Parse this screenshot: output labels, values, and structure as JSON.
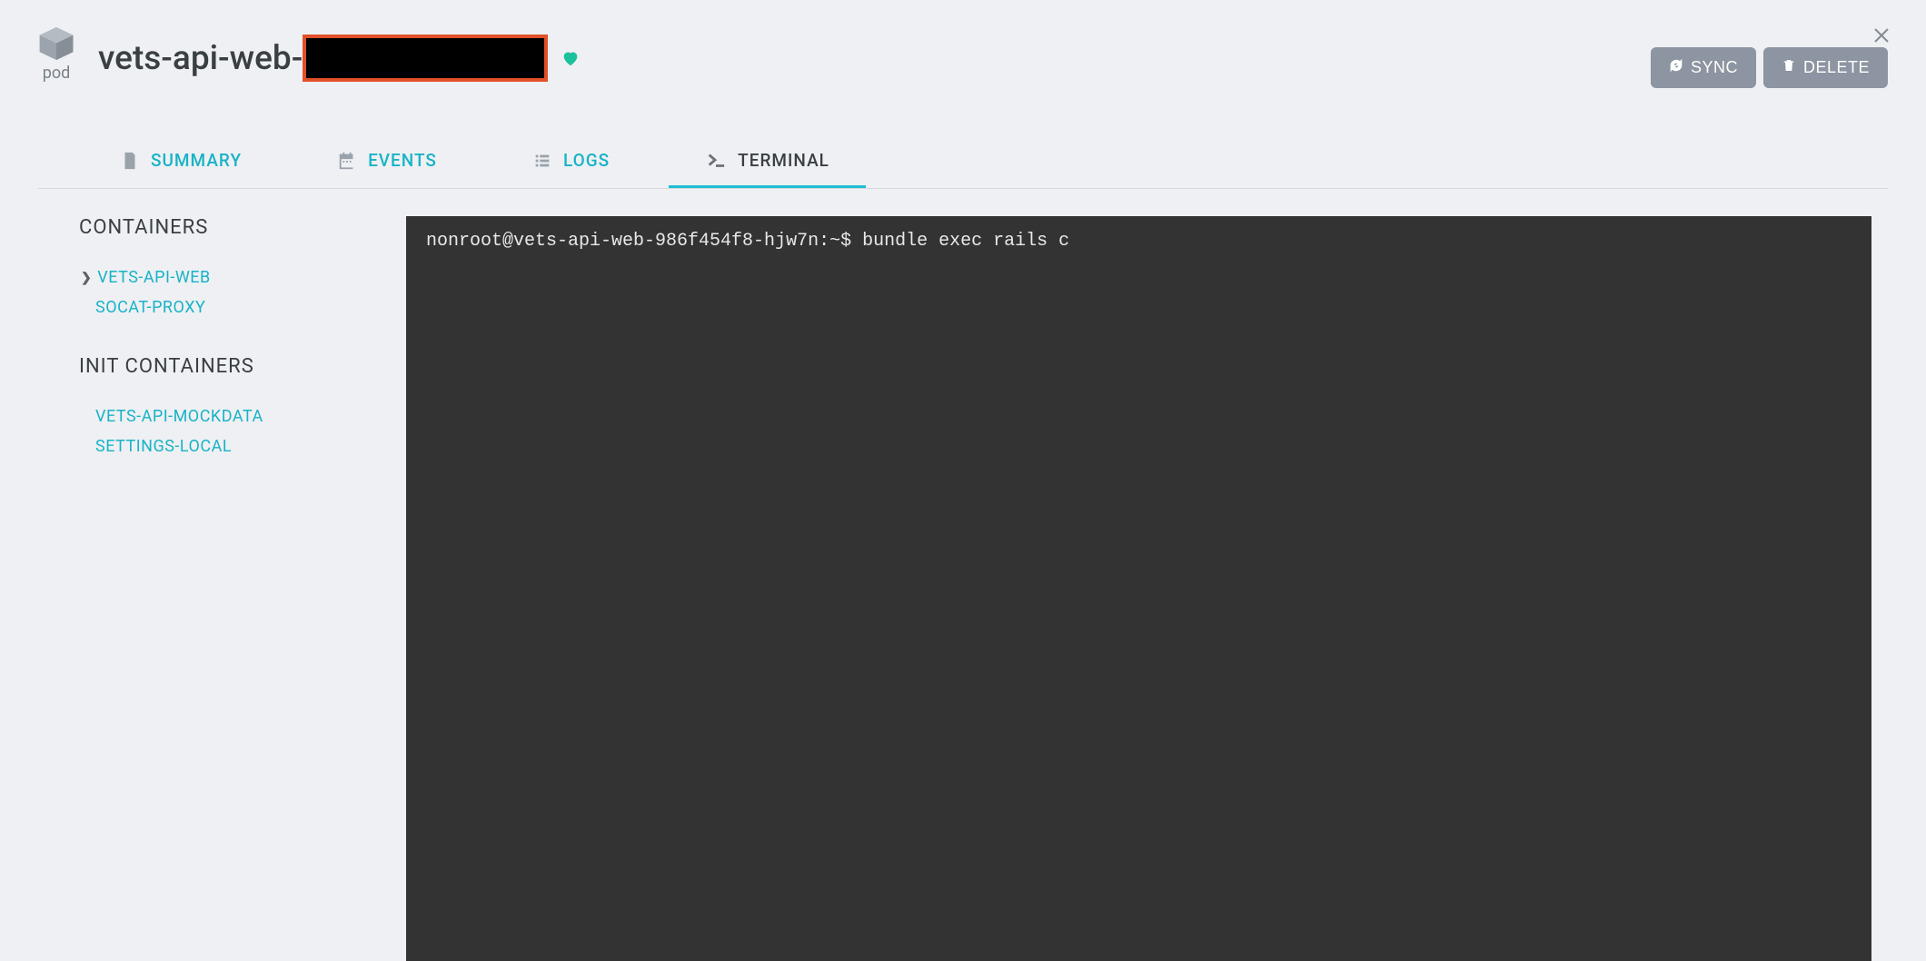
{
  "header": {
    "kind_label": "pod",
    "pod_name_prefix": "vets-api-web-",
    "sync_button": "SYNC",
    "delete_button": "DELETE"
  },
  "tabs": [
    {
      "id": "summary",
      "label": "SUMMARY",
      "active": false
    },
    {
      "id": "events",
      "label": "EVENTS",
      "active": false
    },
    {
      "id": "logs",
      "label": "LOGS",
      "active": false
    },
    {
      "id": "terminal",
      "label": "TERMINAL",
      "active": true
    }
  ],
  "sidebar": {
    "containers_title": "CONTAINERS",
    "init_containers_title": "INIT CONTAINERS",
    "containers": [
      {
        "label": "VETS-API-WEB",
        "selected": true
      },
      {
        "label": "SOCAT-PROXY",
        "selected": false
      }
    ],
    "init_containers": [
      {
        "label": "VETS-API-MOCKDATA"
      },
      {
        "label": "SETTINGS-LOCAL"
      }
    ]
  },
  "terminal": {
    "line": "nonroot@vets-api-web-986f454f8-hjw7n:~$ bundle exec rails c"
  }
}
